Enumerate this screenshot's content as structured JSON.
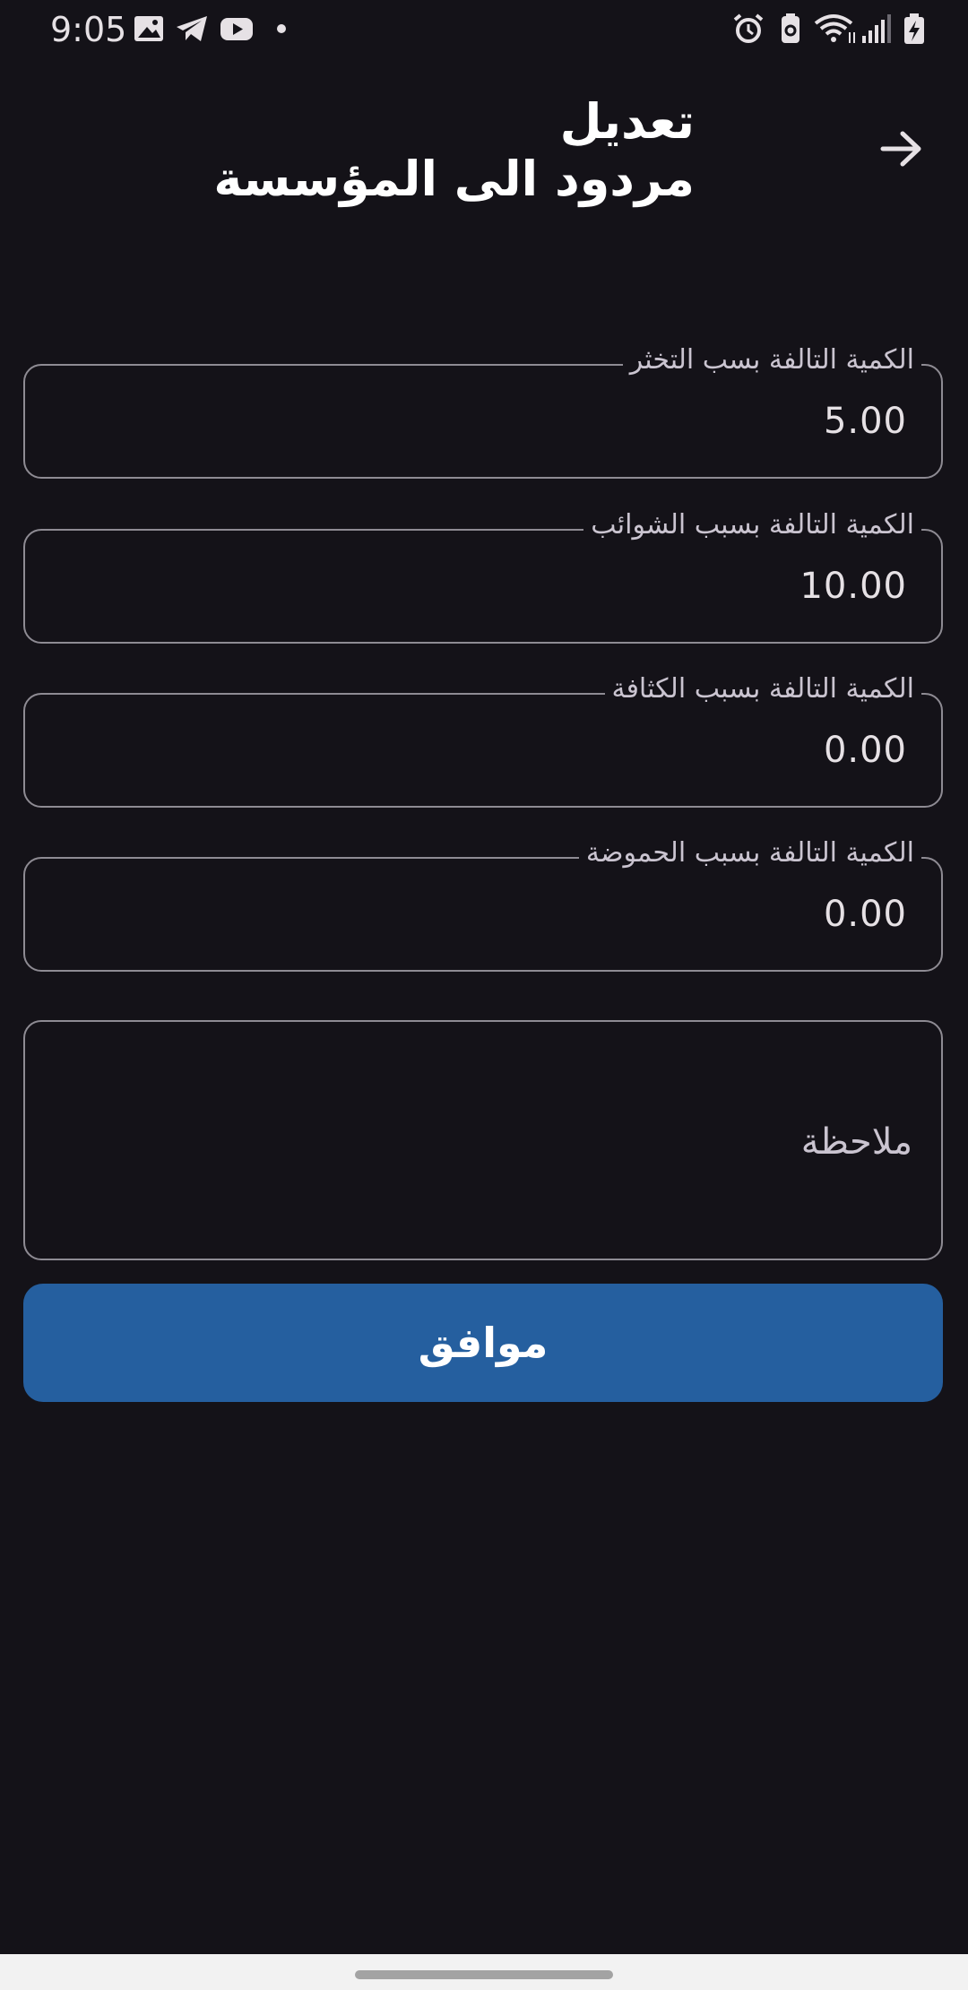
{
  "status_bar": {
    "time": "9:05",
    "left_icons": [
      "image-icon",
      "telegram-icon",
      "youtube-icon",
      "dot-icon"
    ],
    "right_icons": [
      "alarm-icon",
      "battery-saver-icon",
      "wifi-icon",
      "signal-icon",
      "battery-charging-icon"
    ]
  },
  "header": {
    "title_line1": "تعديل",
    "title_line2": "مردود الى المؤسسة",
    "back_icon": "arrow-right-icon"
  },
  "form": {
    "fields": [
      {
        "label": "الكمية التالفة بسب التخثر",
        "value": "5.00"
      },
      {
        "label": "الكمية التالفة بسبب الشوائب",
        "value": "10.00"
      },
      {
        "label": "الكمية التالفة بسبب الكثافة",
        "value": "0.00"
      },
      {
        "label": "الكمية التالفة بسبب الحموضة",
        "value": "0.00"
      }
    ],
    "note_placeholder": "ملاحظة",
    "submit_label": "موافق"
  },
  "colors": {
    "background": "#141218",
    "button": "#255f9f",
    "outline": "#8e8b93"
  }
}
